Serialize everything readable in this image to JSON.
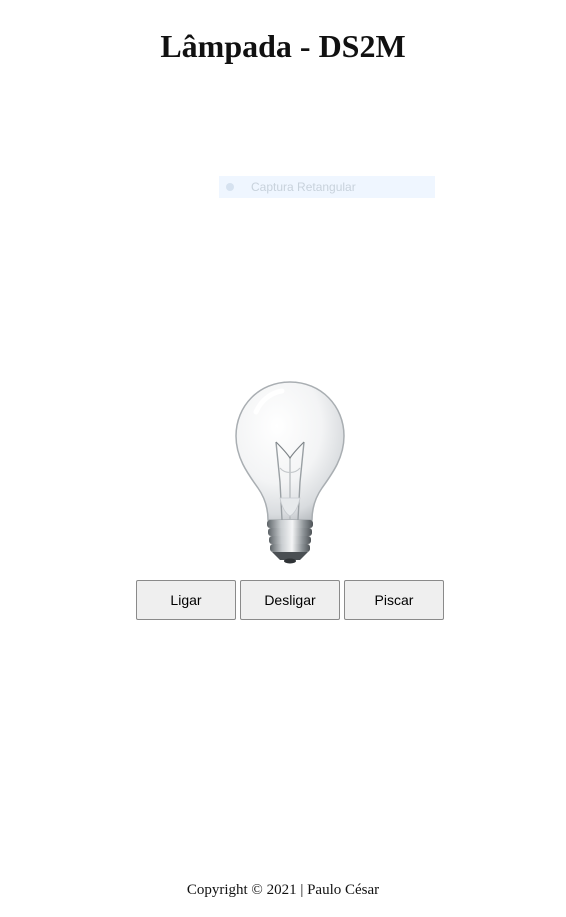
{
  "page": {
    "title": "Lâmpada - DS2M"
  },
  "overlay": {
    "label": "Captura Retangular"
  },
  "lamp": {
    "state": "off",
    "icon": "light-bulb-icon"
  },
  "controls": {
    "on_label": "Ligar",
    "off_label": "Desligar",
    "blink_label": "Piscar"
  },
  "footer": {
    "text": "Copyright © 2021 | Paulo César"
  },
  "colors": {
    "background": "#ffffff",
    "button_bg": "#efefef",
    "button_border": "#8a8a8a"
  }
}
